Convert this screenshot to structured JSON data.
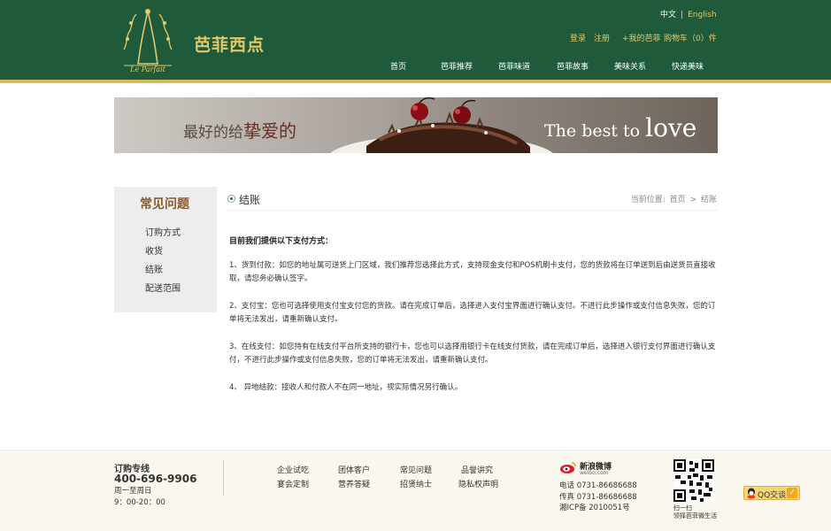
{
  "header": {
    "logo_text": "Le Parfait",
    "brand_name": "芭菲西点",
    "lang": {
      "zh": "中文",
      "sep": "|",
      "en": "English"
    },
    "util": {
      "login": "登录",
      "register": "注册",
      "my_account": "+我的芭菲",
      "cart": "购物车（0）件"
    },
    "nav": [
      "首页",
      "芭菲推荐",
      "芭菲味道",
      "芭菲故事",
      "美味关系",
      "快递美味"
    ]
  },
  "banner": {
    "cn_prefix": "最好的给",
    "cn_big": "挚爱的",
    "en_text": "The best to",
    "en_love": "love"
  },
  "sidebar": {
    "title": "常见问题",
    "items": [
      "订购方式",
      "收货",
      "结账",
      "配送范围"
    ]
  },
  "main": {
    "heading": "结账",
    "breadcrumb": {
      "label": "当前位置:",
      "home": "首页",
      "sep": ">",
      "current": "结账"
    },
    "intro": "目前我们提供以下支付方式：",
    "paragraphs": [
      "1、货到付款：如您的地址属可送货上门区域，我们推荐您选择此方式，支持现金支付和POS机刷卡支付，您的货款将在订单送到后由送货员直接收取，请您务必确认签字。",
      "2、支付宝：您也可选择使用支付宝支付您的货款。请在完成订单后，选择进入支付宝界面进行确认支付。不进行此步操作或支付信息失败，您的订单将无法发出，请重新确认支付。",
      "3、在线支付：如您持有在线支付平台所支持的银行卡，您也可以选择用银行卡在线支付货款，请在完成订单后，选择进入银行支付界面进行确认支付，不进行此步操作或支付信息失败，您的订单将无法发出，请重新确认支付。",
      "4、  异地结款：接收人和付款人不在同一地址，视实际情况另行确认。"
    ]
  },
  "footer": {
    "order_label": "订购专线",
    "phone": "400-696-9906",
    "days": "周一至周日",
    "hours": "9：00-20：00",
    "links": [
      "企业试吃",
      "团体客户",
      "常见问题",
      "品誉讲究",
      "宴会定制",
      "营养答疑",
      "招贤纳士",
      "隐私权声明"
    ],
    "weibo_brand": "新浪微博",
    "weibo_url": "weibo.com",
    "tel": "电话 0731-86686688",
    "fax": "传真 0731-86686688",
    "icp": "湘ICP备 2010051号",
    "qr_line1": "扫一扫",
    "qr_line2": "领择芭菲微生活",
    "qq_label": "QQ交谈"
  },
  "colors": {
    "header_green": "#1f5b3a",
    "gold_accent": "#e3c86a",
    "stripe_gold": "#d2b861",
    "sidebar_title_brown": "#8a5a2c",
    "footer_bg": "#faf8ee"
  },
  "icons": [
    "logo-emblem",
    "bullet-circle-icon",
    "weibo-icon",
    "qr-code",
    "qq-icon",
    "check-icon"
  ]
}
